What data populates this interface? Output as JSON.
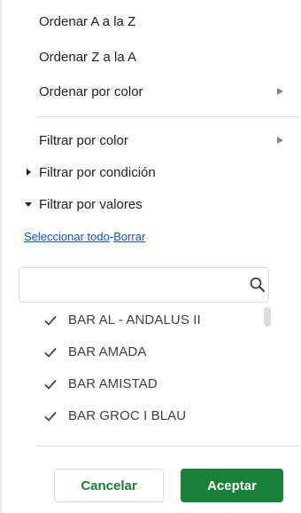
{
  "menu": {
    "sort_az": "Ordenar A a la Z",
    "sort_za": "Ordenar Z a la A",
    "sort_by_color": "Ordenar por color",
    "filter_by_color": "Filtrar por color",
    "filter_by_condition": "Filtrar por condición",
    "filter_by_values": "Filtrar por valores"
  },
  "links": {
    "select_all": "Seleccionar todo",
    "separator": "-",
    "clear": "Borrar"
  },
  "search": {
    "value": "",
    "placeholder": ""
  },
  "values": [
    {
      "label": "BAR AL - ANDALUS II",
      "checked": true
    },
    {
      "label": "BAR AMADA",
      "checked": true
    },
    {
      "label": "BAR AMISTAD",
      "checked": true
    },
    {
      "label": "BAR GROC I BLAU",
      "checked": true
    }
  ],
  "buttons": {
    "cancel": "Cancelar",
    "ok": "Aceptar"
  },
  "colors": {
    "accent": "#188038",
    "link": "#1155cc"
  }
}
